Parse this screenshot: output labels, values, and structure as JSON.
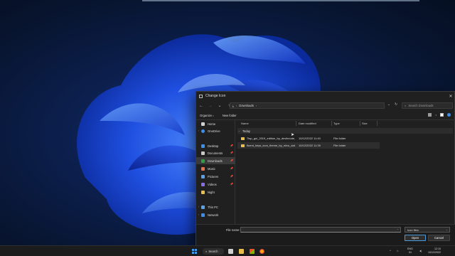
{
  "dialog": {
    "title": "Change Icon",
    "close": "✕",
    "nav": {
      "back": "←",
      "forward": "→",
      "up_menu": "⌄",
      "up": "↑"
    },
    "address": {
      "separator": "›",
      "location": "Downloads",
      "trailing": "›",
      "dropdown": "⌄",
      "refresh": "↻"
    },
    "search": {
      "placeholder": "Search Downloads"
    },
    "command_bar": {
      "organize": "Organize",
      "organize_caret": "▾",
      "new_folder": "New folder",
      "view_caret": "▾"
    },
    "sidebar": {
      "items": [
        {
          "label": "Home",
          "icon": "home-icon",
          "expander": "",
          "pin": ""
        },
        {
          "label": "OneDrive",
          "icon": "onedrive-icon",
          "expander": "›",
          "pin": ""
        },
        {
          "label": "Desktop",
          "icon": "desktop-icon",
          "expander": "",
          "pin": "📌"
        },
        {
          "label": "Documents",
          "icon": "documents-icon",
          "expander": "",
          "pin": "📌"
        },
        {
          "label": "Downloads",
          "icon": "downloads-icon",
          "expander": "",
          "pin": "📌"
        },
        {
          "label": "Music",
          "icon": "music-icon",
          "expander": "",
          "pin": "📌"
        },
        {
          "label": "Pictures",
          "icon": "pictures-icon",
          "expander": "",
          "pin": "📌"
        },
        {
          "label": "Videos",
          "icon": "videos-icon",
          "expander": "",
          "pin": "📌"
        },
        {
          "label": "Night",
          "icon": "folder-icon",
          "expander": "",
          "pin": ""
        },
        {
          "label": "This PC",
          "icon": "pc-icon",
          "expander": "›",
          "pin": ""
        },
        {
          "label": "Network",
          "icon": "network-icon",
          "expander": "›",
          "pin": ""
        }
      ]
    },
    "columns": {
      "name": "Name",
      "date": "Date modified",
      "type": "Type",
      "size": "Size"
    },
    "group": {
      "caret": "⌄",
      "label": "Today"
    },
    "files": [
      {
        "name": "7tsp_gui_2019_edition_by_devilmode_...",
        "date": "10/12/2022 11:40",
        "type": "File folder",
        "size": ""
      },
      {
        "name": "fluent_keys_icon_theme_by_niivu_da8f3d",
        "date": "10/12/2022 11:39",
        "type": "File folder",
        "size": ""
      }
    ],
    "footer": {
      "file_name_label": "File name:",
      "file_name_value": "",
      "dropdown": "⌄",
      "file_type": "Icon files",
      "open": "Open",
      "cancel": "Cancel"
    }
  },
  "taskbar": {
    "search_label": "Search",
    "search_icon": "⌕",
    "tray_expand": "^",
    "lang_line1": "ENG",
    "lang_line2": "IN",
    "time": "12:10",
    "date": "10/12/2022",
    "colors": {
      "start": "#3b9bef",
      "accent": "#4d9bd8"
    }
  }
}
